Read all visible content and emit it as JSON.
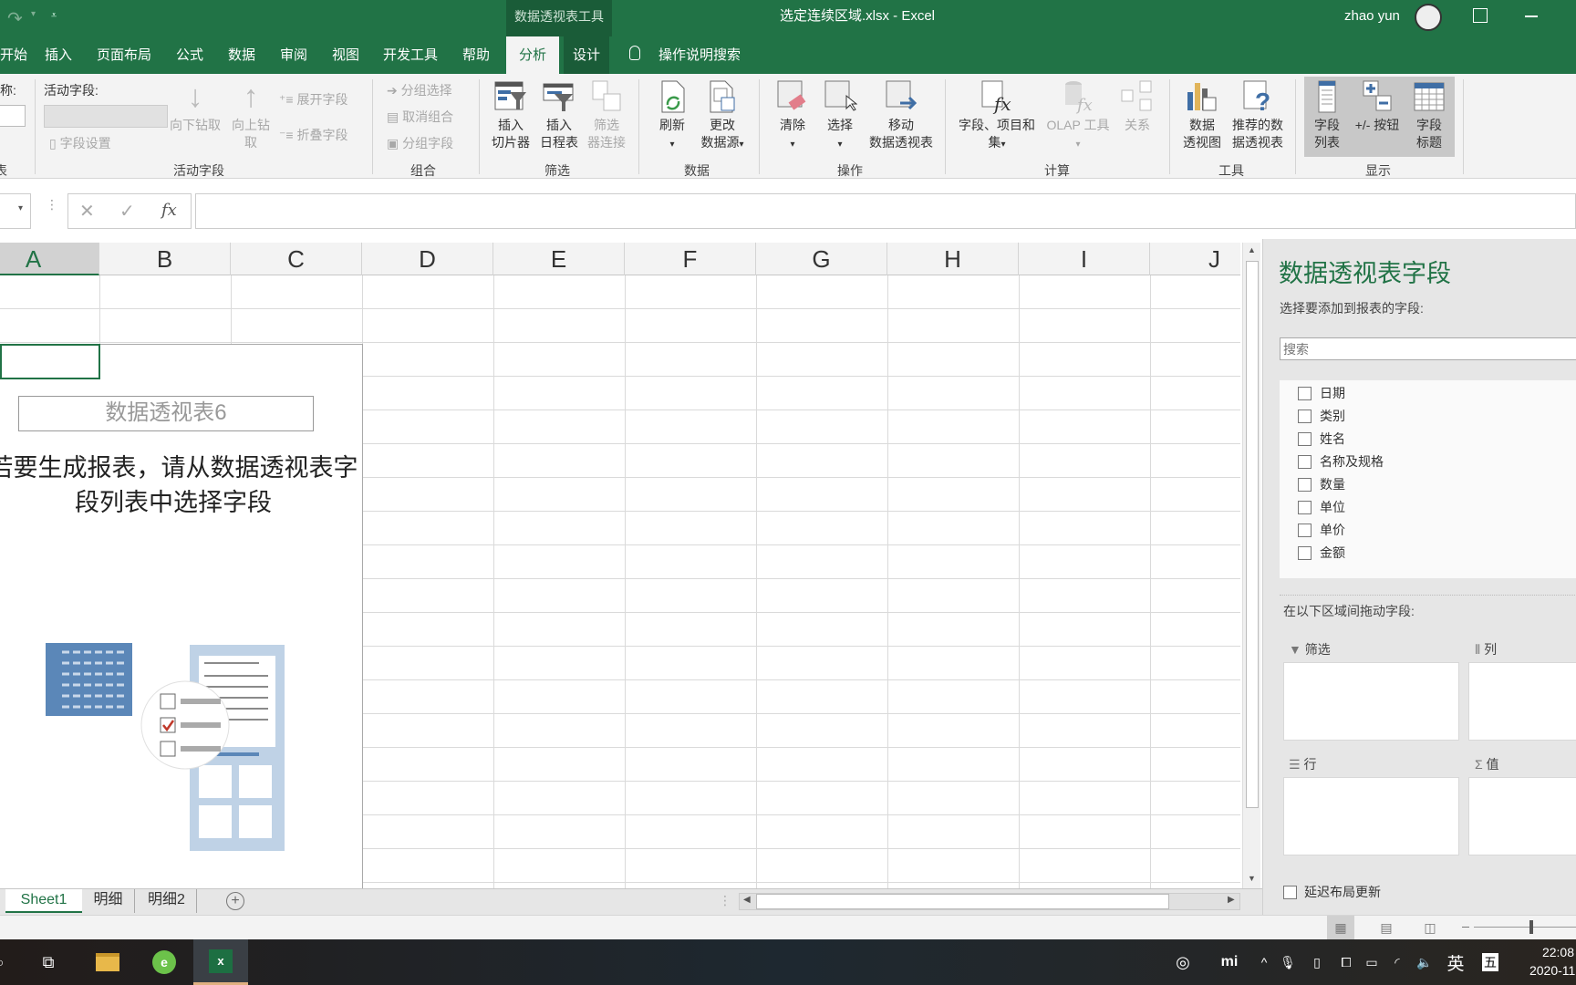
{
  "titlebar": {
    "context_tool": "数据透视表工具",
    "doc_title": "选定连续区域.xlsx  -  Excel",
    "user": "zhao yun"
  },
  "tabs": [
    "开始",
    "插入",
    "页面布局",
    "公式",
    "数据",
    "审阅",
    "视图",
    "开发工具",
    "帮助",
    "分析",
    "设计"
  ],
  "active_tab": "分析",
  "tell_me": "操作说明搜索",
  "ribbon": {
    "pivot_group": {
      "name_label": "名称:",
      "label": "数据透视表"
    },
    "active_field": {
      "field_label": "活动字段:",
      "field_settings": "字段设置",
      "drill_down": "向下钻取",
      "drill_up_1": "向上钻",
      "drill_up_2": "取",
      "expand": "展开字段",
      "collapse": "折叠字段",
      "label": "活动字段"
    },
    "group": {
      "group_selection": "分组选择",
      "ungroup": "取消组合",
      "group_field": "分组字段",
      "label": "组合"
    },
    "filter": {
      "slicer_1": "插入",
      "slicer_2": "切片器",
      "timeline_1": "插入",
      "timeline_2": "日程表",
      "conn_1": "筛选",
      "conn_2": "器连接",
      "label": "筛选"
    },
    "data": {
      "refresh": "刷新",
      "change_1": "更改",
      "change_2": "数据源",
      "label": "数据"
    },
    "actions": {
      "clear": "清除",
      "select": "选择",
      "move_1": "移动",
      "move_2": "数据透视表",
      "label": "操作"
    },
    "calc": {
      "fields_1": "字段、项目和",
      "fields_2": "集",
      "olap": "OLAP 工具",
      "relations": "关系",
      "label": "计算"
    },
    "tools": {
      "chart_1": "数据",
      "chart_2": "透视图",
      "rec_1": "推荐的数",
      "rec_2": "据透视表",
      "label": "工具"
    },
    "show": {
      "fieldlist_1": "字段",
      "fieldlist_2": "列表",
      "buttons": "+/- 按钮",
      "headers_1": "字段",
      "headers_2": "标题",
      "label": "显示"
    }
  },
  "formula_bar": {
    "fx": "fx",
    "value": ""
  },
  "columns": [
    "A",
    "B",
    "C",
    "D",
    "E",
    "F",
    "G",
    "H",
    "I",
    "J"
  ],
  "pivot_placeholder": {
    "name": "数据透视表6",
    "line1": "若要生成报表，请从数据透视表字",
    "line2": "段列表中选择字段"
  },
  "field_panel": {
    "title": "数据透视表字段",
    "subtitle": "选择要添加到报表的字段:",
    "search_placeholder": "搜索",
    "fields": [
      "日期",
      "类别",
      "姓名",
      "名称及规格",
      "数量",
      "单位",
      "单价",
      "金额"
    ],
    "drag_label": "在以下区域间拖动字段:",
    "areas": {
      "filters": "筛选",
      "columns": "列",
      "rows": "行",
      "values": "值"
    },
    "defer": "延迟布局更新"
  },
  "sheets": [
    "Sheet1",
    "明细",
    "明细2"
  ],
  "active_sheet": "Sheet1",
  "tray": {
    "ime_lang": "英",
    "ime_mode": "五",
    "time": "22:08",
    "date": "2020-11-"
  },
  "colors": {
    "excel_green": "#217346",
    "panel_title": "#217346"
  }
}
